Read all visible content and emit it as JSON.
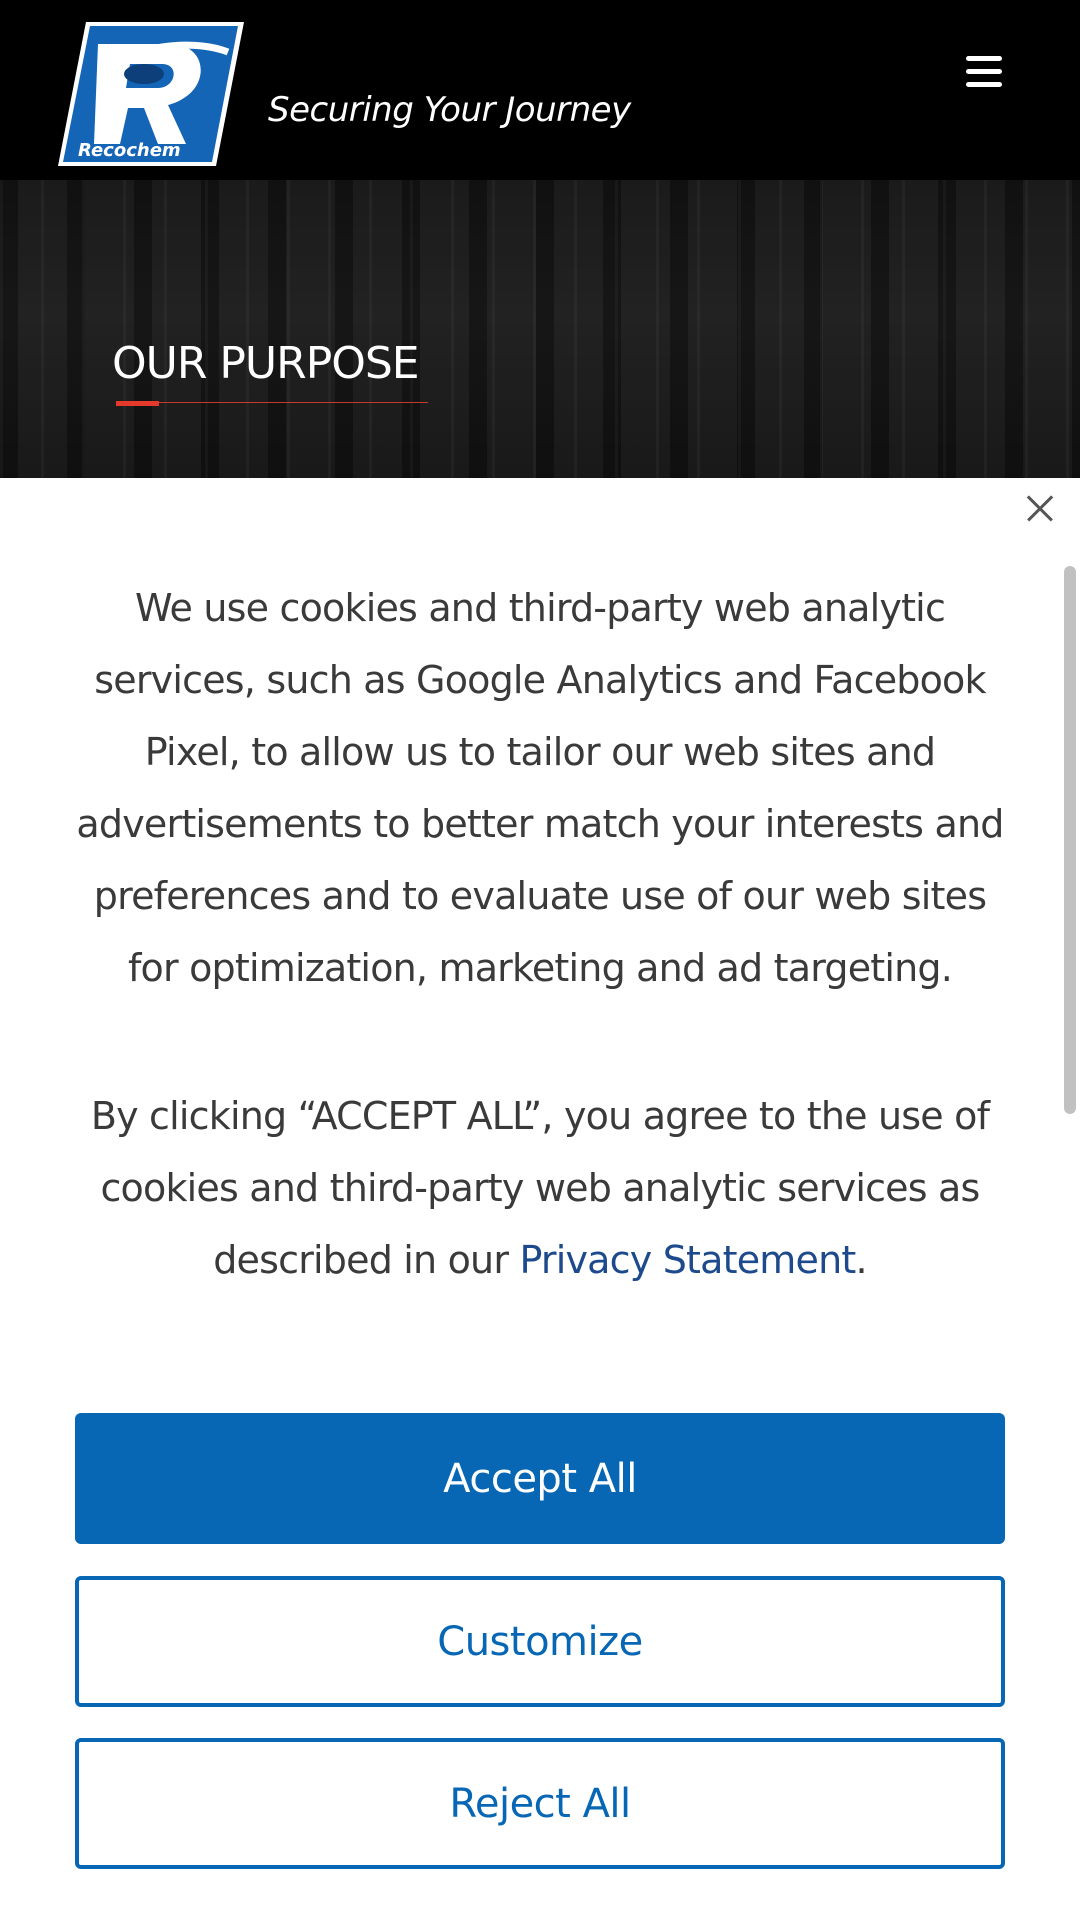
{
  "header": {
    "logo_text": "Recochem",
    "tagline": "Securing Your Journey",
    "menu_icon": "hamburger-menu-icon"
  },
  "hero": {
    "title": "OUR PURPOSE"
  },
  "cookie_banner": {
    "paragraph1": "We use cookies and third-party web analytic services, such as Google Analytics and Facebook Pixel, to allow us to tailor our web sites and advertisements to better match your interests and preferences and to evaluate use of our web sites for optimization, marketing and ad targeting.",
    "paragraph2_prefix": "By clicking “ACCEPT ALL”, you agree to the use of cookies and third-party web analytic services as described in our ",
    "privacy_link": "Privacy Statement",
    "paragraph2_suffix": ".",
    "close_icon": "close-icon",
    "buttons": {
      "accept_all": "Accept All",
      "customize": "Customize",
      "reject_all": "Reject All"
    }
  },
  "colors": {
    "header_bg": "#000000",
    "accent_red": "#e53a2b",
    "brand_blue": "#0767b4",
    "link_blue": "#1d4a8c",
    "body_text": "#3a3a3a"
  }
}
